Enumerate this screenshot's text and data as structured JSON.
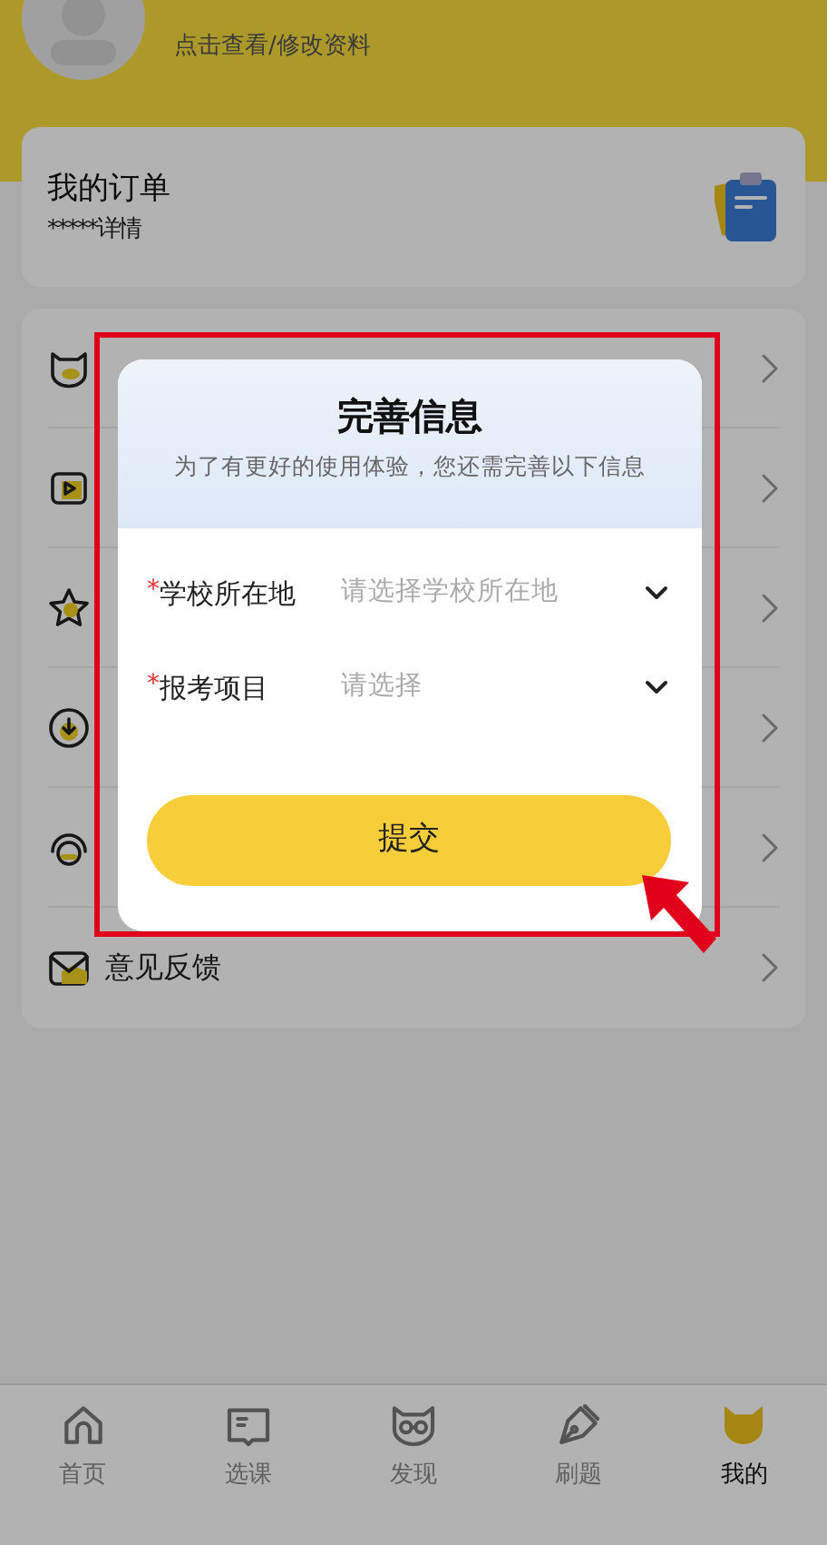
{
  "profile": {
    "subtitle": "点击查看/修改资料"
  },
  "orders": {
    "title": "我的订单",
    "subtitle": "*****详情"
  },
  "menu": [
    {
      "kind": "icon-only"
    },
    {
      "kind": "icon-only"
    },
    {
      "kind": "icon-only"
    },
    {
      "kind": "icon-only"
    },
    {
      "kind": "icon-only"
    },
    {
      "kind": "labeled",
      "label": "意见反馈"
    }
  ],
  "dialog": {
    "title": "完善信息",
    "subtitle": "为了有更好的使用体验，您还需完善以下信息",
    "fields": [
      {
        "mark": "*",
        "label": "学校所在地",
        "placeholder": "请选择学校所在地"
      },
      {
        "mark": "*",
        "label": "报考项目",
        "placeholder": "请选择"
      }
    ],
    "submit": "提交"
  },
  "tab_bar": [
    {
      "label": "首页",
      "selected": false
    },
    {
      "label": "选课",
      "selected": false
    },
    {
      "label": "发现",
      "selected": false
    },
    {
      "label": "刷题",
      "selected": false
    },
    {
      "label": "我的",
      "selected": true
    }
  ]
}
